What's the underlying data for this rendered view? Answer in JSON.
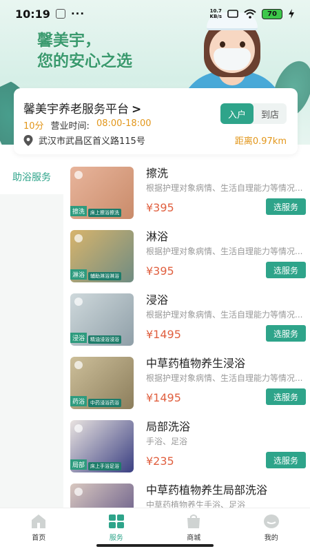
{
  "status_bar": {
    "time": "10:19",
    "dots": "···",
    "net_speed_value": "10.7",
    "net_speed_unit": "KB/s",
    "battery": "70"
  },
  "banner": {
    "line1": "馨美宇，",
    "line2": "您的安心之选"
  },
  "store": {
    "name": "馨美宇养老服务平台",
    "chevron": ">",
    "toggle_options": [
      "入户",
      "到店"
    ],
    "selected_toggle": "入户",
    "time_estimate": "10分",
    "hours_label": "营业时间:",
    "hours": "08:00-18:00",
    "address": "武汉市武昌区首义路115号",
    "distance": "距离0.97km"
  },
  "sidebar": {
    "items": [
      {
        "label": "助浴服务",
        "active": true
      }
    ]
  },
  "services": [
    {
      "title": "擦洗",
      "desc": "根据护理对象病情、生活自理能力等情况...",
      "price": "¥395",
      "button": "选服务",
      "thumb_tag": "擦洗",
      "thumb_banner": "床上擦浴擦洗",
      "colors": [
        "#c98b6a",
        "#e8b59c"
      ]
    },
    {
      "title": "淋浴",
      "desc": "根据护理对象病情、生活自理能力等情况...",
      "price": "¥395",
      "button": "选服务",
      "thumb_tag": "淋浴",
      "thumb_banner": "辅助淋浴淋浴",
      "colors": [
        "#6f8c82",
        "#d8b46c"
      ]
    },
    {
      "title": "浸浴",
      "desc": "根据护理对象病情、生活自理能力等情况...",
      "price": "¥1495",
      "button": "选服务",
      "thumb_tag": "浸浴",
      "thumb_banner": "精油浸浴浸浴",
      "colors": [
        "#8f9fa8",
        "#cfd9dc"
      ]
    },
    {
      "title": "中草药植物养生浸浴",
      "desc": "根据护理对象病情、生活自理能力等情况...",
      "price": "¥1495",
      "button": "选服务",
      "thumb_tag": "药浴",
      "thumb_banner": "中药浸浴药浴",
      "colors": [
        "#8c7e5c",
        "#cdbf9a"
      ]
    },
    {
      "title": "局部洗浴",
      "desc": "手浴、足浴",
      "price": "¥235",
      "button": "选服务",
      "thumb_tag": "局部",
      "thumb_banner": "床上手浴足浴",
      "colors": [
        "#3a3f82",
        "#e9e3e0"
      ]
    },
    {
      "title": "中草药植物养生局部洗浴",
      "desc": "中草药植物养生手浴、足浴",
      "price": "",
      "button": "",
      "thumb_tag": "",
      "thumb_banner": "",
      "colors": [
        "#5a4f82",
        "#d9c8c0"
      ]
    }
  ],
  "tabbar": {
    "tabs": [
      {
        "label": "首页",
        "icon": "home-icon",
        "active": false
      },
      {
        "label": "服务",
        "icon": "grid-icon",
        "active": true
      },
      {
        "label": "商城",
        "icon": "bag-icon",
        "active": false
      },
      {
        "label": "我的",
        "icon": "profile-icon",
        "active": false
      }
    ]
  },
  "accent_color": "#2ea48a",
  "price_color": "#e06040",
  "highlight_color": "#e2961a"
}
